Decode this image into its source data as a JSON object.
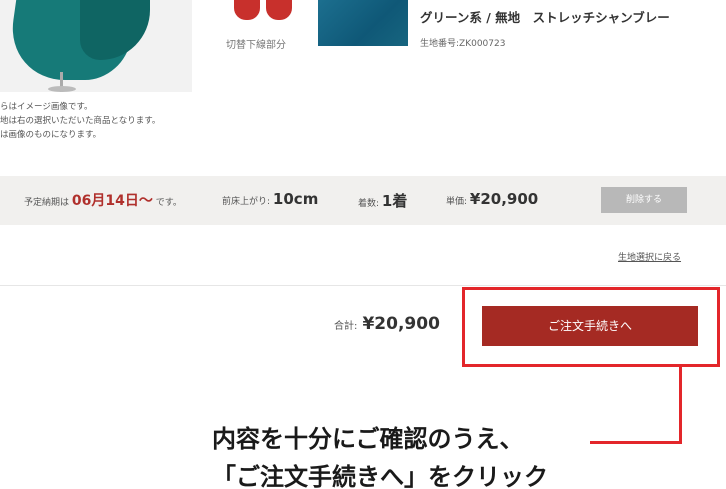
{
  "product": {
    "lining_label": "切替下線部分",
    "fabric_name": "グリーン系 / 無地　ストレッチシャンブレー",
    "fabric_code": "生地番号:ZK000723"
  },
  "notes": [
    "らはイメージ画像です。",
    "地は右の選択いただいた商品となります。",
    "は画像のものになります。"
  ],
  "order_summary": {
    "delivery_prefix": "予定納期は",
    "delivery_date": "06月14日〜",
    "delivery_suffix": "です。",
    "length_label": "前床上がり:",
    "length_value": "10cm",
    "quantity_label": "着数:",
    "quantity_value": "1着",
    "price_label": "単価:",
    "price_value": "¥20,900",
    "delete_label": "削除する"
  },
  "back_link": "生地選択に戻る",
  "total": {
    "label": "合計:",
    "value": "¥20,900"
  },
  "checkout_label": "ご注文手続きへ",
  "instruction": {
    "line1": "内容を十分にご確認のうえ、",
    "line2": "「ご注文手続きへ」をクリック"
  },
  "colors": {
    "accent": "#a52a23",
    "highlight": "#e3262a",
    "date": "#b0302c"
  }
}
